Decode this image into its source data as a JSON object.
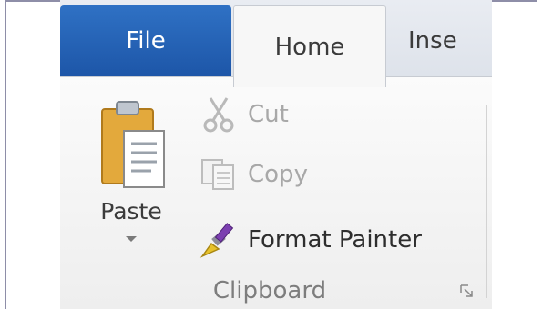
{
  "tabs": {
    "file": "File",
    "home": "Home",
    "insert": "Inse"
  },
  "clipboard": {
    "paste_label": "Paste",
    "cut_label": "Cut",
    "copy_label": "Copy",
    "format_painter_label": "Format Painter",
    "group_label": "Clipboard"
  },
  "icons": {
    "paste": "clipboard-paste-icon",
    "cut": "scissors-icon",
    "copy": "copy-icon",
    "format_painter": "paintbrush-icon",
    "launcher": "dialog-launcher-icon"
  },
  "colors": {
    "file_tab": "#2a67bb",
    "disabled_text": "#a8a8a8",
    "text": "#2e2e2e",
    "group_label": "#7d7d7d"
  }
}
